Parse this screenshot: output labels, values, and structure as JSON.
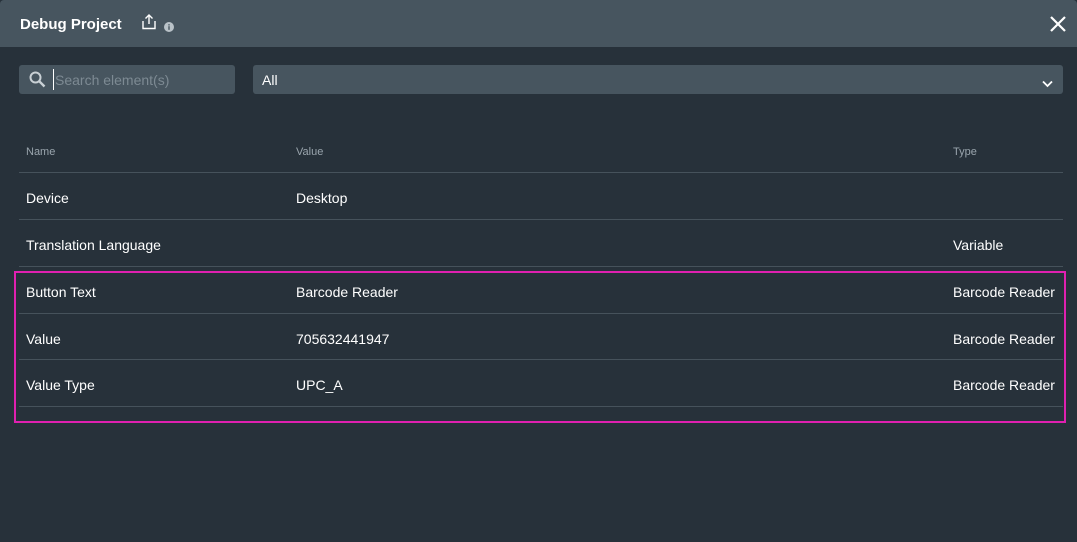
{
  "header": {
    "title": "Debug Project",
    "share_icon": "share-export-icon",
    "info_icon": "info-icon",
    "close_icon": "close-icon"
  },
  "search": {
    "placeholder": "Search element(s)",
    "value": ""
  },
  "filter": {
    "selected": "All"
  },
  "table": {
    "columns": [
      "Name",
      "Value",
      "Type"
    ],
    "rows": [
      {
        "name": "Device",
        "value": "Desktop",
        "type": ""
      },
      {
        "name": "Translation Language",
        "value": "",
        "type": "Variable"
      },
      {
        "name": "Button Text",
        "value": "Barcode Reader",
        "type": "Barcode Reader"
      },
      {
        "name": "Value",
        "value": "705632441947",
        "type": "Barcode Reader"
      },
      {
        "name": "Value Type",
        "value": "UPC_A",
        "type": "Barcode Reader"
      }
    ]
  },
  "colors": {
    "background": "#27313a",
    "header_bg": "#47555f",
    "highlight": "#e020b0"
  }
}
